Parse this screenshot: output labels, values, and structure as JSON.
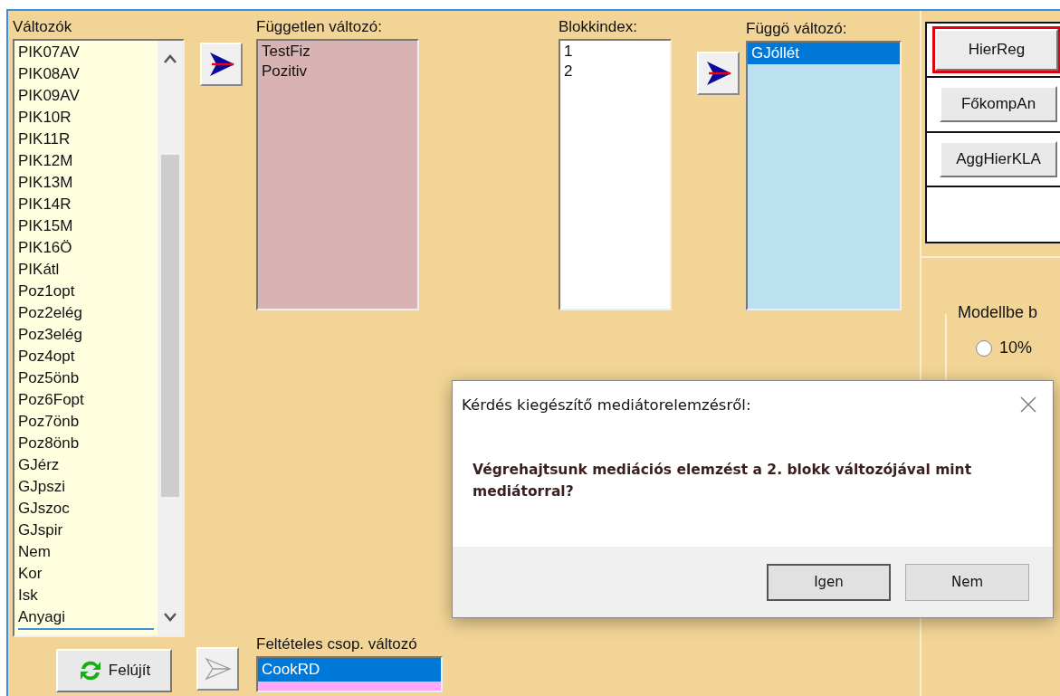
{
  "variables": {
    "label": "Változók",
    "items": [
      {
        "text": "PIK07AV",
        "focused": false
      },
      {
        "text": "PIK08AV",
        "focused": false
      },
      {
        "text": "PIK09AV",
        "focused": false
      },
      {
        "text": "PIK10R",
        "focused": false
      },
      {
        "text": "PIK11R",
        "focused": false
      },
      {
        "text": "PIK12M",
        "focused": false
      },
      {
        "text": "PIK13M",
        "focused": false
      },
      {
        "text": "PIK14R",
        "focused": false
      },
      {
        "text": "PIK15M",
        "focused": false
      },
      {
        "text": "PIK16Ö",
        "focused": false
      },
      {
        "text": "PIKátl",
        "focused": false
      },
      {
        "text": "Poz1opt",
        "focused": false
      },
      {
        "text": "Poz2elég",
        "focused": false
      },
      {
        "text": "Poz3elég",
        "focused": false
      },
      {
        "text": "Poz4opt",
        "focused": false
      },
      {
        "text": "Poz5önb",
        "focused": false
      },
      {
        "text": "Poz6Fopt",
        "focused": false
      },
      {
        "text": "Poz7önb",
        "focused": false
      },
      {
        "text": "Poz8önb",
        "focused": false
      },
      {
        "text": "GJérz",
        "focused": false
      },
      {
        "text": "GJpszi",
        "focused": false
      },
      {
        "text": "GJszoc",
        "focused": false
      },
      {
        "text": "GJspir",
        "focused": false
      },
      {
        "text": "Nem",
        "focused": false
      },
      {
        "text": "Kor",
        "focused": false
      },
      {
        "text": "Isk",
        "focused": false
      },
      {
        "text": "Anyagi",
        "focused": true
      }
    ]
  },
  "transfer_buttons": [
    {
      "disabled": false
    },
    {
      "disabled": false
    },
    {
      "disabled": true
    }
  ],
  "independent": {
    "label": "Független változó:",
    "items": [
      "TestFiz",
      "Pozitiv"
    ]
  },
  "block_index": {
    "label": "Blokkindex:",
    "items": [
      "1",
      "2"
    ]
  },
  "dependent": {
    "label": "Függö változó:",
    "items": [
      {
        "text": "GJóllét",
        "selected": true
      }
    ]
  },
  "refresh_button": "Felújít",
  "conditional_group": {
    "label": "Feltételes csop. változó",
    "value": "CookRD"
  },
  "analysis_buttons": [
    {
      "label": "HierReg",
      "selected": true
    },
    {
      "label": "FőkompAn",
      "selected": false
    },
    {
      "label": "AggHierKLA",
      "selected": false
    }
  ],
  "model_group": {
    "label": "Modellbe b",
    "options": [
      {
        "label": "10%",
        "selected": false
      }
    ]
  },
  "dialog": {
    "title": "Kérdés kiegészítő mediátorelemzésről:",
    "message": "Végrehajtsunk mediációs elemzést a 2. blokk változójával mint mediátorral?",
    "buttons": [
      {
        "label": "Igen",
        "focused": true
      },
      {
        "label": "Nem",
        "focused": false
      }
    ]
  }
}
